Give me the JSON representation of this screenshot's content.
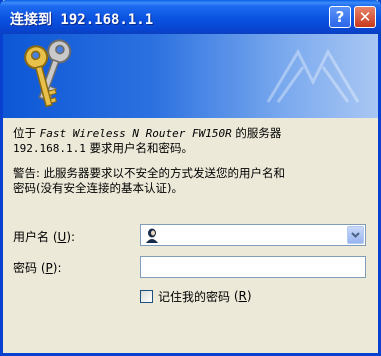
{
  "window": {
    "title": "连接到 192.168.1.1",
    "help_glyph": "?",
    "close_glyph": "✕"
  },
  "banner": {
    "icon": "keys-icon"
  },
  "message": {
    "line1_prefix": "位于 ",
    "device_name": "Fast Wireless N Router FW150R",
    "line1_suffix": " 的服务器",
    "address": "192.168.1.1",
    "line2_suffix": " 要求用户名和密码。",
    "warning_line1": "警告: 此服务器要求以不安全的方式发送您的用户名和",
    "warning_line2": "密码(没有安全连接的基本认证)。"
  },
  "form": {
    "username_label": "用户名",
    "username_accel": "U",
    "password_label": "密码",
    "password_accel": "P",
    "username_value": "",
    "password_value": "",
    "remember_label": "记住我的密码",
    "remember_accel": "R",
    "remember_checked": false
  },
  "colors": {
    "titlebar": "#0a52e0",
    "window_bg": "#ece9d8",
    "field_border": "#7f9db9"
  }
}
